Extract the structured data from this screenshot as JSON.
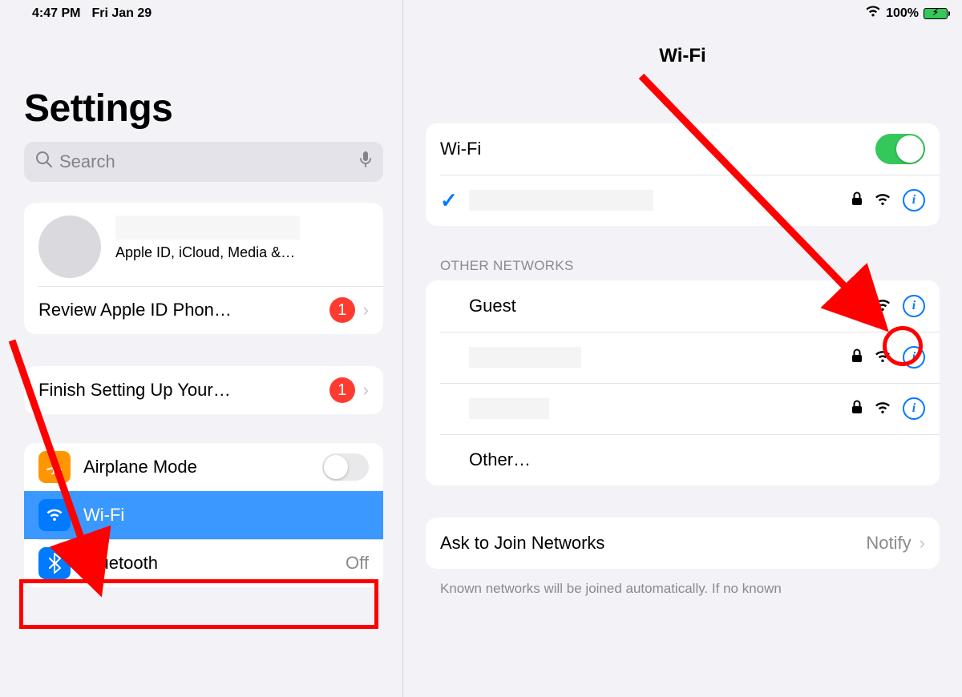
{
  "status": {
    "time": "4:47 PM",
    "date": "Fri Jan 29",
    "battery_pct": "100%"
  },
  "sidebar": {
    "title": "Settings",
    "search_placeholder": "Search",
    "profile_sub": "Apple ID, iCloud, Media &…",
    "review_label": "Review Apple ID Phon…",
    "review_badge": "1",
    "finish_label": "Finish Setting Up Your…",
    "finish_badge": "1",
    "airplane_label": "Airplane Mode",
    "wifi_label": "Wi-Fi",
    "bluetooth_label": "Bluetooth",
    "bluetooth_value": "Off"
  },
  "detail": {
    "title": "Wi-Fi",
    "wifi_label": "Wi-Fi",
    "wifi_on": true,
    "other_header": "OTHER NETWORKS",
    "networks": {
      "guest": "Guest",
      "other": "Other…"
    },
    "ask_label": "Ask to Join Networks",
    "ask_value": "Notify",
    "footer": "Known networks will be joined automatically. If no known"
  }
}
